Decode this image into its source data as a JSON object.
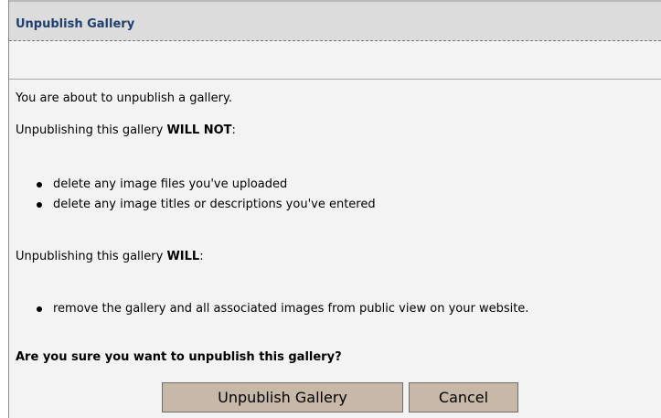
{
  "dialog": {
    "title": "Unpublish Gallery",
    "intro": "You are about to unpublish a gallery.",
    "will_not_prefix": "Unpublishing this gallery ",
    "will_not_emphasis": "WILL NOT",
    "will_not_suffix": ":",
    "will_not_items": [
      "delete any image files you've uploaded",
      "delete any image titles or descriptions you've entered"
    ],
    "will_prefix": "Unpublishing this gallery ",
    "will_emphasis": "WILL",
    "will_suffix": ":",
    "will_items": [
      "remove the gallery and all associated images from public view on your website."
    ],
    "question": "Are you sure you want to unpublish this gallery?",
    "buttons": {
      "unpublish": "Unpublish Gallery",
      "cancel": "Cancel"
    }
  },
  "colors": {
    "title_text": "#1f3f6e",
    "title_bar": "#dcdcdc",
    "body_bg": "#f3f3f3",
    "button_bg": "#c8b8a8"
  }
}
